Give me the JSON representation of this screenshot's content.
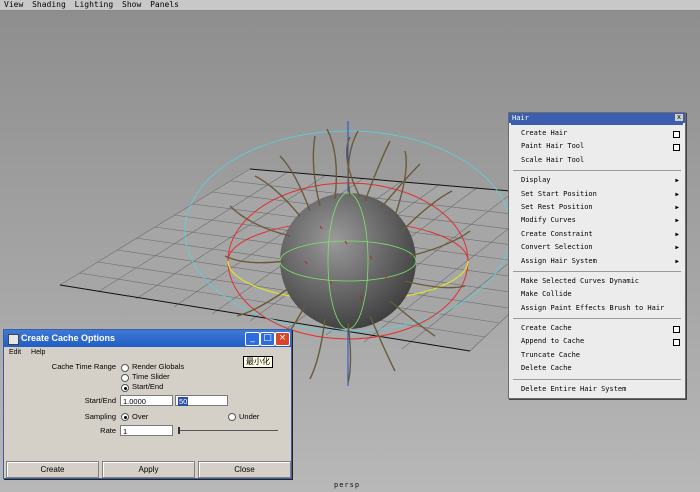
{
  "menubar": [
    "View",
    "Shading",
    "Lighting",
    "Show",
    "Panels"
  ],
  "viewport": {
    "label": "persp"
  },
  "hair_menu": {
    "title": "Hair",
    "groups": [
      [
        {
          "label": "Create Hair",
          "option": true
        },
        {
          "label": "Paint Hair Tool",
          "option": true
        },
        {
          "label": "Scale Hair Tool"
        }
      ],
      [
        {
          "label": "Display",
          "submenu": true
        },
        {
          "label": "Set Start Position",
          "submenu": true
        },
        {
          "label": "Set Rest Position",
          "submenu": true
        },
        {
          "label": "Modify Curves",
          "submenu": true
        },
        {
          "label": "Create Constraint",
          "submenu": true
        },
        {
          "label": "Convert Selection",
          "submenu": true
        },
        {
          "label": "Assign Hair System",
          "submenu": true
        }
      ],
      [
        {
          "label": "Make Selected Curves Dynamic"
        },
        {
          "label": "Make Collide"
        },
        {
          "label": "Assign Paint Effects Brush to Hair"
        }
      ],
      [
        {
          "label": "Create Cache",
          "option": true
        },
        {
          "label": "Append to Cache",
          "option": true
        },
        {
          "label": "Truncate Cache"
        },
        {
          "label": "Delete Cache"
        }
      ],
      [
        {
          "label": "Delete Entire Hair System"
        }
      ]
    ]
  },
  "dialog": {
    "title": "Create Cache Options",
    "menu": [
      "Edit",
      "Help"
    ],
    "cache_range_label": "Cache Time Range",
    "range_options": [
      "Render Globals",
      "Time Slider",
      "Start/End"
    ],
    "range_selected": 2,
    "startend_label": "Start/End",
    "start_value": "1.0000",
    "end_value": "50",
    "sampling_label": "Sampling",
    "sampling_options": [
      "Over",
      "Under"
    ],
    "rate_label": "Rate",
    "rate_value": "1",
    "tooltip": "最小化",
    "buttons": [
      "Create",
      "Apply",
      "Close"
    ]
  }
}
